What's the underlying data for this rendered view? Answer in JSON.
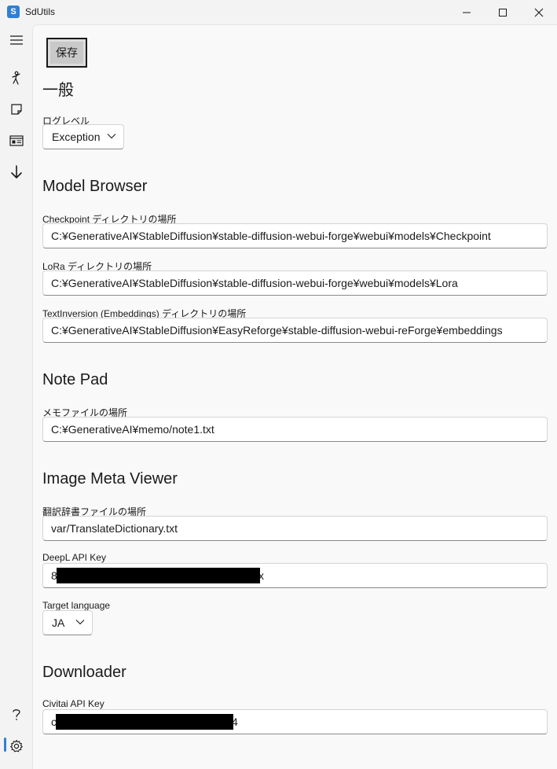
{
  "window": {
    "title": "SdUtils",
    "icon_letter": "S"
  },
  "nav": {
    "icons": [
      "menu-icon",
      "person-pose-icon",
      "note-icon",
      "image-meta-icon",
      "download-arrow-icon"
    ],
    "bottom_icons": [
      "help-icon",
      "settings-icon"
    ]
  },
  "toolbar": {
    "save_label": "保存"
  },
  "general": {
    "heading": "一般",
    "loglevel_label": "ログレベル",
    "loglevel_value": "Exception"
  },
  "model_browser": {
    "heading": "Model Browser",
    "checkpoint_label": "Checkpoint ディレクトリの場所",
    "checkpoint_value": "C:¥GenerativeAI¥StableDiffusion¥stable-diffusion-webui-forge¥webui¥models¥Checkpoint",
    "lora_label": "LoRa ディレクトリの場所",
    "lora_value": "C:¥GenerativeAI¥StableDiffusion¥stable-diffusion-webui-forge¥webui¥models¥Lora",
    "embeddings_label": "TextInversion (Embeddings) ディレクトリの場所",
    "embeddings_value": "C:¥GenerativeAI¥StableDiffusion¥EasyReforge¥stable-diffusion-webui-reForge¥embeddings"
  },
  "note_pad": {
    "heading": "Note Pad",
    "memo_label": "メモファイルの場所",
    "memo_value": "C:¥GenerativeAI¥memo/note1.txt"
  },
  "image_meta_viewer": {
    "heading": "Image Meta Viewer",
    "dict_label": "翻訳辞書ファイルの場所",
    "dict_value": "var/TranslateDictionary.txt",
    "deepl_label": "DeepL API Key",
    "deepl_prefix": "8",
    "deepl_suffix": "x",
    "target_label": "Target language",
    "target_value": "JA"
  },
  "downloader": {
    "heading": "Downloader",
    "civitai_label": "Civitai API Key",
    "civitai_prefix": "c",
    "civitai_suffix": "4"
  },
  "colors": {
    "accent": "#2f7fd6",
    "content_bg": "#f9f9f9",
    "shell_bg": "#f3f3f3"
  }
}
